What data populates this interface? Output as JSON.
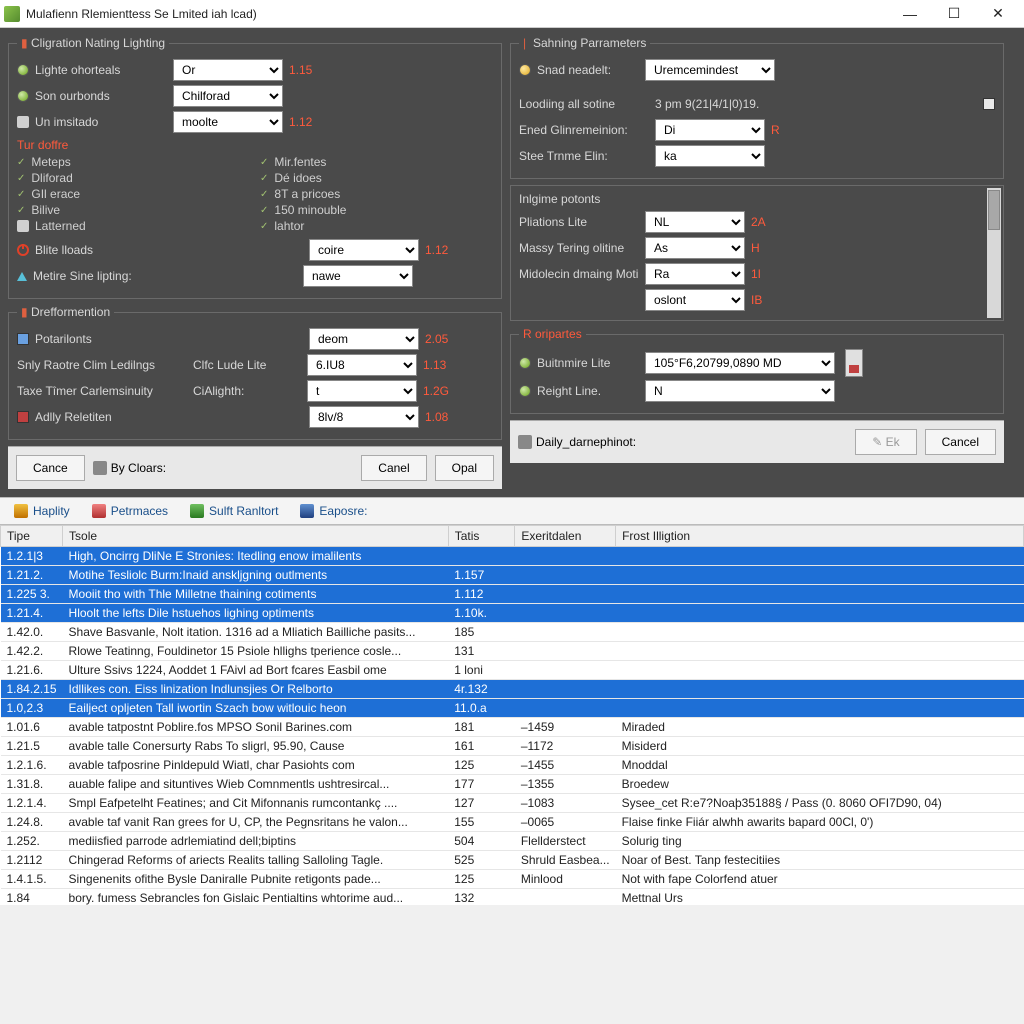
{
  "window": {
    "title": "Mulafienn Rlemienttess Se Lmited iah lcad)"
  },
  "left": {
    "group1_title": "Cligration Nating Lighting",
    "r1_label": "Lighte ohorteals",
    "r1_sel": "Or",
    "r1_val": "1.15",
    "r2_label": "Son ourbonds",
    "r2_sel": "Chilforad",
    "r3_label": "Un imsitado",
    "r3_sel": "moolte",
    "r3_val": "1.12",
    "sub1": "Tur doffre",
    "listL": [
      "Meteps",
      "Dliforad",
      "GIl erace",
      "Bilive",
      "Latterned"
    ],
    "listR": [
      "Mir.fentes",
      "Dé idoes",
      "8T a pricoes",
      "150 minouble",
      "lahtor"
    ],
    "r4_label": "Blite lloads",
    "r4_sel": "coire",
    "r4_val": "1.12",
    "r5_label": "Metire Sine lipting:",
    "r5_sel": "nawe",
    "group2_title": "Drefformention",
    "r6_label": "Potarilonts",
    "r6_sel": "deom",
    "r6_val": "2.05",
    "r7_label": "Snly Raotre Clim Ledilngs",
    "r7_lbl2": "Clfc Lude Lite",
    "r7_sel": "6.IU8",
    "r7_val": "1.13",
    "r8_label": "Taxe Tîmer Carlemsinuity",
    "r8_lbl2": "CiAlighth:",
    "r8_sel": "t",
    "r8_val": "1.2G",
    "r9_label": "Adlly Reletiten",
    "r9_sel": "8lv/8",
    "r9_val": "1.08",
    "btn_cance": "Cance",
    "btn_clears": "By Cloars:",
    "btn_canel": "Canel",
    "btn_opal": "Opal"
  },
  "right": {
    "group1_title": "Sahning Parrameters",
    "r1_label": "Snad neadelt:",
    "r1_sel": "Uremcemindest",
    "loading_lbl": "Loodiing all sotine",
    "loading_val": "3 pm 9(21|4/1|0)19.",
    "r2_label": "Ened Glinremeinion:",
    "r2_sel": "Di",
    "r2_val": "R",
    "r3_label": "Stee Trnme Elin:",
    "r3_sel": "ka",
    "sub1": "Inlgime potonts",
    "p1_label": "Pliations Lite",
    "p1_sel": "NL",
    "p1_val": "2A",
    "p2_label": "Massy Tering olitine",
    "p2_sel": "As",
    "p2_val": "H",
    "p3_label": "Midolecin dmaing Motirdundafily antiule",
    "p3_sel": "Ra",
    "p3_val": "1I",
    "p4_sel": "oslont",
    "p4_val": "IB",
    "sub2": "R oripartes",
    "b1_label": "Buitnmire Lite",
    "b1_sel": "105°F6,20799,0890 MD",
    "b2_label": "Reight Line.",
    "b2_sel": "N",
    "footer_label": "Daily_darnephinot:",
    "btn_ok": "Ek",
    "btn_cancel": "Cancel"
  },
  "tabs": [
    "Haplity",
    "Petrmaces",
    "Sulft Ranltort",
    "Eaposre:"
  ],
  "grid": {
    "cols": [
      "Tipe",
      "Tsole",
      "Tatis",
      "Exeritdalen",
      "Frost Illigtion"
    ],
    "rows": [
      {
        "sel": true,
        "c": [
          "1.2.1|3",
          "High, Oncirrg DliNe E Stronies: Itedling enow imalilents",
          "",
          "",
          ""
        ]
      },
      {
        "sel": true,
        "c": [
          "1.21.2.",
          "Motihe Tesliolc Burm:Inaid anskljgning outlments",
          "1.157",
          "",
          ""
        ]
      },
      {
        "sel": true,
        "c": [
          "1.225 3.",
          "Mooiit tho with Thle Milletne thaining cotiments",
          "1.112",
          "",
          ""
        ]
      },
      {
        "sel": true,
        "c": [
          "1.21.4.",
          "Hloolt the lefts Dile hstuehos lighing optiments",
          "1.10k.",
          "",
          ""
        ]
      },
      {
        "sel": false,
        "c": [
          "1.42.0.",
          "Shave Basvanle, Nolt itation. 1316 ad a Mliatich Bailliche pasits...",
          "185",
          "",
          ""
        ]
      },
      {
        "sel": false,
        "c": [
          "1.42.2.",
          "Rlowe Teatinng, Fouldinetor 15 Psiole hllighs tperience cosle...",
          "131",
          "",
          ""
        ]
      },
      {
        "sel": false,
        "c": [
          "1.21.6.",
          "Ulture Ssivs 1224, Aoddet 1 FAivl ad Bort fcares Easbil ome",
          "1 loni",
          "",
          ""
        ]
      },
      {
        "sel": true,
        "c": [
          "1.84.2.15",
          "Idllikes con. Eiss linization Indlunsjies Or Relborto",
          "4r.132",
          "",
          ""
        ]
      },
      {
        "sel": true,
        "c": [
          "1.0,2.3",
          "Eailject opljeten Tall iwortin Szach bow witlouic heon",
          "11.0.a",
          "",
          ""
        ]
      },
      {
        "sel": false,
        "c": [
          "1.01.6",
          "avable tatpostnt Poblire.fos MPSO Sonil Barines.com",
          "181",
          "–1459",
          "Miraded"
        ]
      },
      {
        "sel": false,
        "c": [
          "1.21.5",
          "avable talle Conersurty Rabs To sligrl, 95.90, Cause",
          "161",
          "–1172",
          "Misiderd"
        ]
      },
      {
        "sel": false,
        "c": [
          "1.2.1.6.",
          "avable tafposrine Pinldepuld Wiatl, char Pasiohts com",
          "125",
          "–1455",
          "Mnoddal"
        ]
      },
      {
        "sel": false,
        "c": [
          "1.31.8.",
          "auable falipe and situntives Wieb Comnmentls ushtresircal...",
          "177",
          "–1355",
          "Broedew"
        ]
      },
      {
        "sel": false,
        "c": [
          "1.2.1.4.",
          "Smpl Eafpetelht Featines; and Cit Mifonnanis rumcontankç ....",
          "127",
          "–1083",
          "Sysee_cet R:e7?Noaþ35188§ / Pass (0. 8060 OFI7D90, 04)"
        ]
      },
      {
        "sel": false,
        "c": [
          "1.24.8.",
          "avable taf vanit Ran grees for U, CP, the Pegnsritans he valon...",
          "155",
          "–0065",
          "Flaise finke Fiiár alwhh awarits bapard 00Cl, 0')"
        ]
      },
      {
        "sel": false,
        "c": [
          "1.252.",
          "mediisfied parrode adrlemiatind dell;biptins",
          "504",
          "Flellderstect",
          "Solurig ting"
        ]
      },
      {
        "sel": false,
        "c": [
          "1.2112",
          "Chingerad Reforms of ariects Realits talling Salloling Tagle.",
          "525",
          "Shruld Easbea...",
          "Noar of Best. Tanp festecitiies"
        ]
      },
      {
        "sel": false,
        "c": [
          "1.4.1.5.",
          "Singenenits ofithe Bysle Daniralle Pubnite retigonts pade...",
          "125",
          "Minlood",
          "Not with fape Colorfend atuer"
        ]
      },
      {
        "sel": false,
        "c": [
          "1.84",
          "bory. fumess Sebrancles fon Gislaic Pentialtins whtorime aud...",
          "132",
          "",
          "Mettnal Urs"
        ]
      }
    ]
  }
}
